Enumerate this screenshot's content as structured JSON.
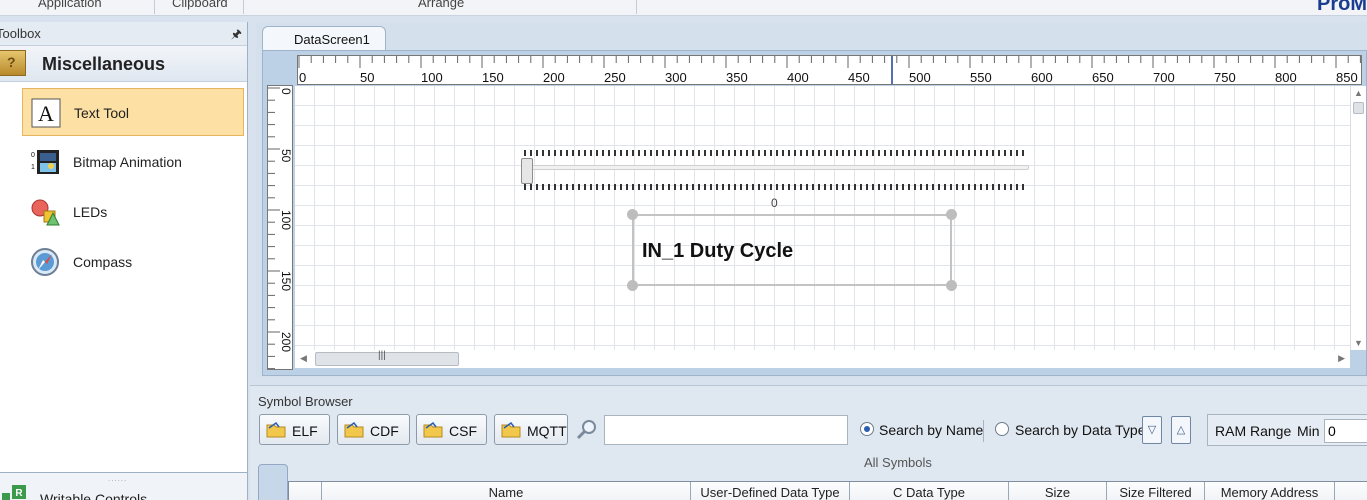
{
  "ribbon": {
    "groups": [
      "Application",
      "Clipboard",
      "Arrange"
    ],
    "brand": "ProM"
  },
  "toolbox": {
    "title": "Toolbox",
    "category": "Miscellaneous",
    "items": [
      {
        "label": "Text Tool",
        "icon": "text-tool-icon",
        "selected": true
      },
      {
        "label": "Bitmap Animation",
        "icon": "bitmap-animation-icon",
        "selected": false
      },
      {
        "label": "LEDs",
        "icon": "leds-icon",
        "selected": false
      },
      {
        "label": "Compass",
        "icon": "compass-icon",
        "selected": false
      }
    ],
    "bottom_category": "Writable Controls"
  },
  "designer": {
    "tab": "DataScreen1",
    "hruler_labels": [
      "0",
      "50",
      "100",
      "150",
      "200",
      "250",
      "300",
      "350",
      "400",
      "450",
      "500",
      "550",
      "600",
      "650",
      "700",
      "750",
      "800",
      "850"
    ],
    "vruler_labels": [
      "0",
      "50",
      "100",
      "150",
      "200"
    ],
    "slider_value": "0",
    "label_text": "IN_1 Duty Cycle",
    "hscroll_grip": "|||"
  },
  "symbol_browser": {
    "title": "Symbol Browser",
    "buttons": [
      "ELF",
      "CDF",
      "CSF",
      "MQTT"
    ],
    "search_value": "",
    "search_by_name": "Search by Name",
    "search_by_type": "Search by Data Type",
    "search_mode": "name",
    "ram_range": "RAM Range",
    "min_label": "Min",
    "min_value": "0",
    "all_symbols": "All Symbols",
    "columns": [
      "",
      "Name",
      "User-Defined Data Type",
      "C Data Type",
      "Size",
      "Size Filtered",
      "Memory Address"
    ]
  },
  "colors": {
    "selection": "#fde0a3",
    "accent": "#2a5db0",
    "brand": "#1a3d8f"
  }
}
